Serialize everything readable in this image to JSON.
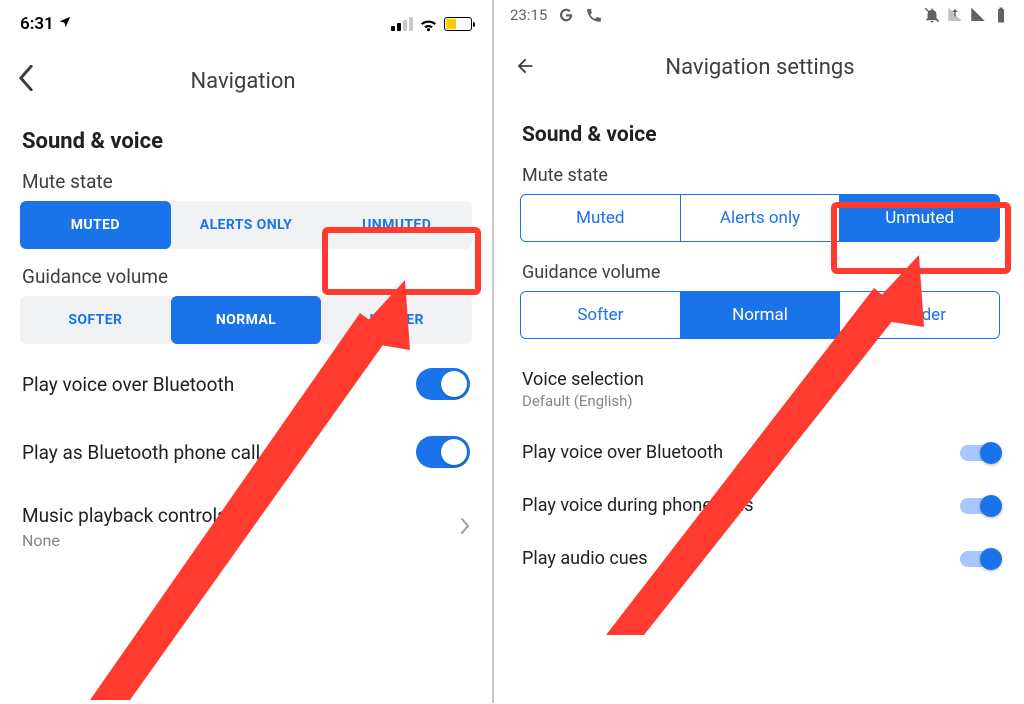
{
  "colors": {
    "accent": "#1a73e8",
    "annotation": "#ff3b2f",
    "battery": "#ffcc00"
  },
  "ios": {
    "status": {
      "time": "6:31",
      "location_icon": "location-arrow",
      "battery_percent": 40
    },
    "header": {
      "back_icon": "chevron-left",
      "title": "Navigation"
    },
    "section_title": "Sound & voice",
    "mute_state": {
      "label": "Mute state",
      "options": [
        "MUTED",
        "ALERTS ONLY",
        "UNMUTED"
      ],
      "selected": 0,
      "highlighted_index": 2
    },
    "guidance_volume": {
      "label": "Guidance volume",
      "options": [
        "SOFTER",
        "NORMAL",
        "LOUDER"
      ],
      "selected": 1
    },
    "toggles": [
      {
        "label": "Play voice over Bluetooth",
        "on": true
      },
      {
        "label": "Play as Bluetooth phone call",
        "on": true
      }
    ],
    "music": {
      "title": "Music playback controls",
      "value": "None"
    }
  },
  "android": {
    "status": {
      "time": "23:15",
      "left_icons": [
        "google-icon",
        "phone-icon"
      ],
      "right_icons": [
        "bell-off-icon",
        "signal-down-icon",
        "signal-icon",
        "battery-full-icon"
      ]
    },
    "header": {
      "back_icon": "arrow-left",
      "title": "Navigation settings"
    },
    "section_title": "Sound & voice",
    "mute_state": {
      "label": "Mute state",
      "options": [
        "Muted",
        "Alerts only",
        "Unmuted"
      ],
      "selected": 2,
      "highlighted_index": 2
    },
    "guidance_volume": {
      "label": "Guidance volume",
      "options": [
        "Softer",
        "Normal",
        "Louder"
      ],
      "selected": 1
    },
    "voice_selection": {
      "title": "Voice selection",
      "value": "Default (English)"
    },
    "toggles": [
      {
        "label": "Play voice over Bluetooth",
        "on": true
      },
      {
        "label": "Play voice during phone calls",
        "on": true
      },
      {
        "label": "Play audio cues",
        "on": true
      }
    ]
  }
}
